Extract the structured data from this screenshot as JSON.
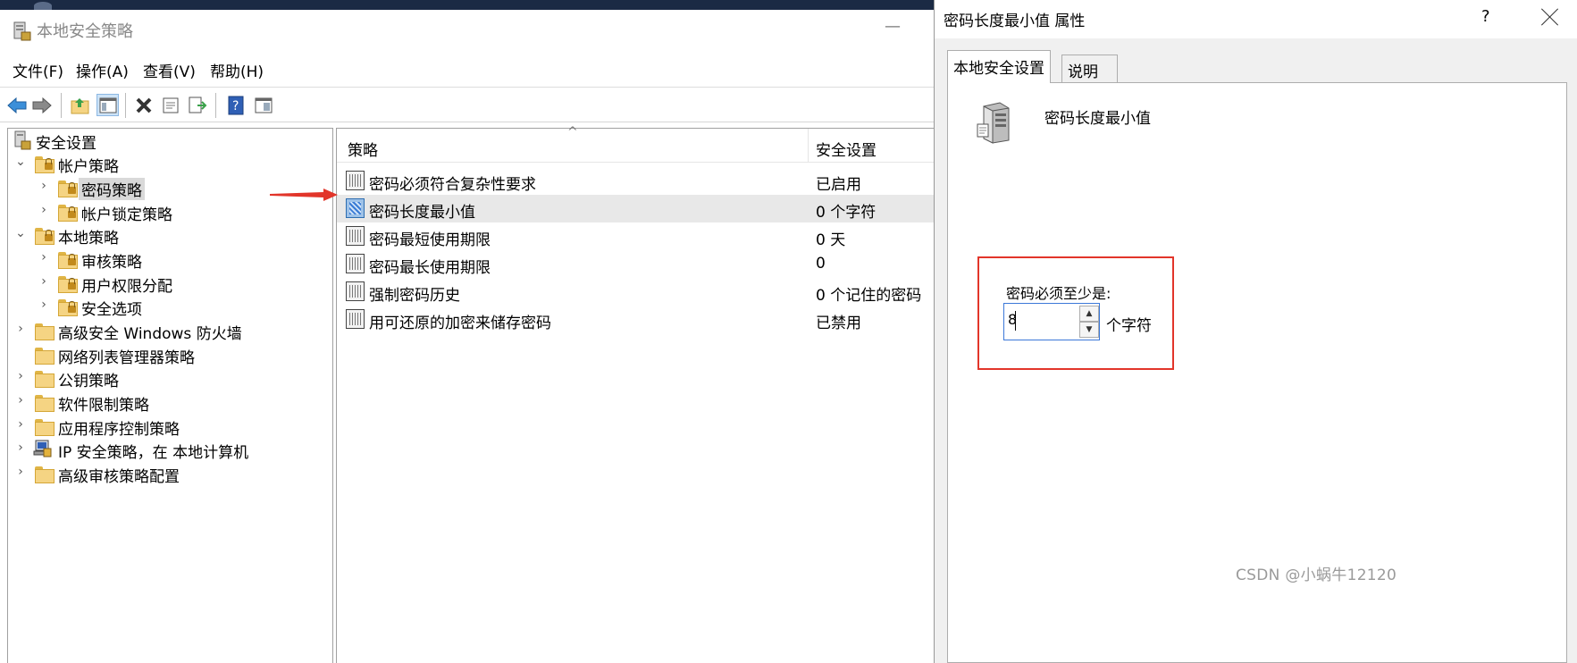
{
  "main_window": {
    "title": "本地安全策略",
    "minimize_glyph": "—"
  },
  "menu": [
    "文件(F)",
    "操作(A)",
    "查看(V)",
    "帮助(H)"
  ],
  "toolbar": {
    "buttons": [
      "back-icon",
      "forward-icon",
      "up-folder-icon",
      "show-hide-tree-icon",
      "delete-icon",
      "properties-icon",
      "export-list-icon",
      "help-icon",
      "console-view-icon"
    ]
  },
  "tree": {
    "root": "安全设置",
    "items": [
      {
        "label": "帐户策略",
        "expanded": true
      },
      {
        "label": "密码策略",
        "selected": true
      },
      {
        "label": "帐户锁定策略"
      },
      {
        "label": "本地策略",
        "expanded": true
      },
      {
        "label": "审核策略"
      },
      {
        "label": "用户权限分配"
      },
      {
        "label": "安全选项"
      },
      {
        "label": "高级安全 Windows 防火墙"
      },
      {
        "label": "网络列表管理器策略"
      },
      {
        "label": "公钥策略"
      },
      {
        "label": "软件限制策略"
      },
      {
        "label": "应用程序控制策略"
      },
      {
        "label": "IP 安全策略，在 本地计算机"
      },
      {
        "label": "高级审核策略配置"
      }
    ]
  },
  "list": {
    "columns": [
      "策略",
      "安全设置"
    ],
    "sort_caret": "^",
    "rows": [
      {
        "policy": "密码必须符合复杂性要求",
        "setting": "已启用"
      },
      {
        "policy": "密码长度最小值",
        "setting": "0 个字符",
        "highlighted": true
      },
      {
        "policy": "密码最短使用期限",
        "setting": "0 天"
      },
      {
        "policy": "密码最长使用期限",
        "setting": "0"
      },
      {
        "policy": "强制密码历史",
        "setting": "0 个记住的密码"
      },
      {
        "policy": "用可还原的加密来储存密码",
        "setting": "已禁用"
      }
    ]
  },
  "dialog": {
    "title": "密码长度最小值 属性",
    "help_glyph": "?",
    "tabs": [
      "本地安全设置",
      "说明"
    ],
    "policy_name": "密码长度最小值",
    "must_label": "密码必须至少是:",
    "value": "8",
    "unit": "个字符",
    "spin_up": "▲",
    "spin_down": "▼"
  },
  "watermark": "CSDN @小蜗牛12120",
  "colors": {
    "annotation_red": "#e2352a",
    "selection_gray": "#d9d9d9",
    "input_focus_blue": "#3c78d8"
  }
}
